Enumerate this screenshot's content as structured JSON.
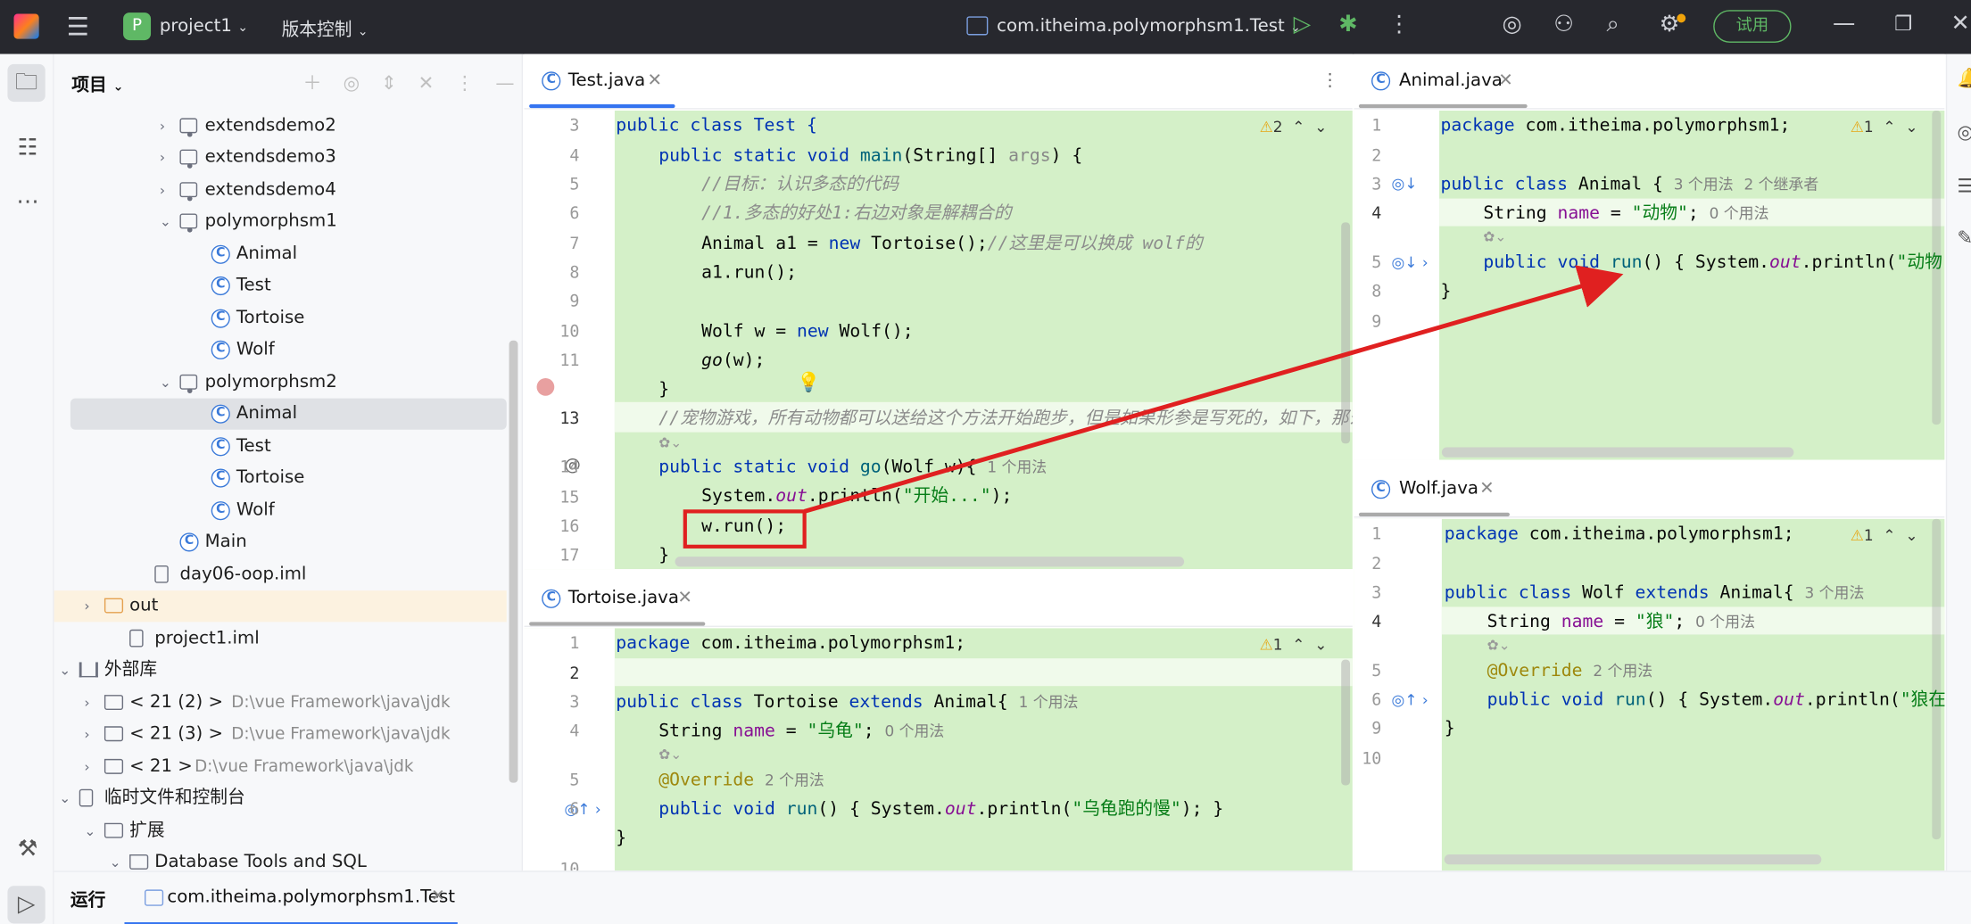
{
  "titlebar": {
    "project_letter": "P",
    "project": "project1",
    "vcs": "版本控制",
    "run_config": "com.itheima.polymorphsm1.Test",
    "trial": "试用"
  },
  "project_panel": {
    "title": "项目",
    "rows": [
      {
        "label": "extendsdemo2",
        "kind": "package",
        "chev": "›"
      },
      {
        "label": "extendsdemo3",
        "kind": "package",
        "chev": "›"
      },
      {
        "label": "extendsdemo4",
        "kind": "package",
        "chev": "›"
      },
      {
        "label": "polymorphsm1",
        "kind": "package",
        "chev": "⌄"
      },
      {
        "label": "Animal",
        "kind": "class"
      },
      {
        "label": "Test",
        "kind": "class-run"
      },
      {
        "label": "Tortoise",
        "kind": "class"
      },
      {
        "label": "Wolf",
        "kind": "class"
      },
      {
        "label": "polymorphsm2",
        "kind": "package",
        "chev": "⌄"
      },
      {
        "label": "Animal",
        "kind": "class"
      },
      {
        "label": "Test",
        "kind": "class-run"
      },
      {
        "label": "Tortoise",
        "kind": "class"
      },
      {
        "label": "Wolf",
        "kind": "class"
      },
      {
        "label": "Main",
        "kind": "class-run"
      },
      {
        "label": "day06-oop.iml",
        "kind": "file"
      },
      {
        "label": "out",
        "kind": "folder-orange",
        "chev": "›"
      },
      {
        "label": "project1.iml",
        "kind": "file"
      },
      {
        "label": "外部库",
        "kind": "lib",
        "chev": "⌄"
      },
      {
        "label": "< 21 (2) >",
        "path": "D:\\vue  Framework\\java\\jdk",
        "kind": "jdk",
        "chev": "›"
      },
      {
        "label": "< 21 (3) >",
        "path": "D:\\vue  Framework\\java\\jdk",
        "kind": "jdk",
        "chev": "›"
      },
      {
        "label": "< 21 >",
        "path": "D:\\vue  Framework\\java\\jdk",
        "kind": "jdk",
        "chev": "›"
      },
      {
        "label": "临时文件和控制台",
        "kind": "scratch",
        "chev": "⌄"
      },
      {
        "label": "扩展",
        "kind": "folder",
        "chev": "⌄"
      },
      {
        "label": "Database Tools and SQL",
        "kind": "folder",
        "chev": "⌄"
      }
    ]
  },
  "editors": {
    "test": {
      "tab": "Test.java",
      "warn": "2"
    },
    "animal": {
      "tab": "Animal.java",
      "warn": "1"
    },
    "tortoise": {
      "tab": "Tortoise.java",
      "warn": "1"
    },
    "wolf": {
      "tab": "Wolf.java",
      "warn": "1"
    }
  },
  "code": {
    "test": {
      "l3": "public class Test {",
      "l4a": "public static void ",
      "l4b": "main",
      "l4c": "(String[] ",
      "l4d": "args",
      ") {": ") {",
      "l5": "//目标：认识多态的代码",
      "l6": "//1.多态的好处1:右边对象是解耦合的",
      "l7a": "Animal a1 = ",
      "l7b": "new ",
      "l7c": "Tortoise();",
      "l7d": "//这里是可以换成 wolf的",
      "l8": "a1.run();",
      "l10a": "Wolf w = ",
      "l10b": "new ",
      "l10c": "Wolf();",
      "l11a": "go",
      "l11b": "(w);",
      "l12": "}",
      "l13": "//宠物游戏，所有动物都可以送给这个方法开始跑步，但是如果形参是写死的，如下，那么就",
      "l14a": "public static void ",
      "l14b": "go",
      "l14c": "(Wolf w){",
      "l14h": "1 个用法",
      "l15a": "System.",
      "l15b": "out",
      "l15c": ".println(",
      "l15d": "\"开始...\"",
      "l15e": ");",
      "l16": "w.run();",
      "l17": "}"
    },
    "animal": {
      "l1a": "package ",
      "l1b": "com.itheima.polymorphsm1;",
      "l3a": "public class ",
      "l3b": "Animal {",
      "l3h1": "3 个用法",
      "l3h2": "2 个继承者",
      "l4a": "String ",
      "l4b": "name",
      " = ": " = ",
      "l4c": "\"动物\"",
      "l4d": ";",
      "l4h": "0 个用法",
      "l5a": "public void ",
      "l5b": "run",
      "l5c": "() { System.",
      "l5d": "out",
      "l5e": ".println(",
      "l5f": "\"动物",
      "l8": "}"
    },
    "tortoise": {
      "l1a": "package ",
      "l1b": "com.itheima.polymorphsm1;",
      "l3a": "public class ",
      "l3b": "Tortoise ",
      "l3c": "extends ",
      "l3d": "Animal{",
      "l3h": "1 个用法",
      "l4a": "String ",
      "l4b": "name",
      " = ": " = ",
      "l4c": "\"乌龟\"",
      "l4d": ";",
      "l4h": "0 个用法",
      "l5a": "@Override",
      "l5h": "2 个用法",
      "l6a": "public void ",
      "l6b": "run",
      "l6c": "() { System.",
      "l6d": "out",
      "l6e": ".println(",
      "l6f": "\"乌龟跑的慢\"",
      "l6g": "); }",
      "l7": "}"
    },
    "wolf": {
      "l1a": "package ",
      "l1b": "com.itheima.polymorphsm1;",
      "l3a": "public class ",
      "l3b": "Wolf ",
      "l3c": "extends ",
      "l3d": "Animal{",
      "l3h": "3 个用法",
      "l4a": "String ",
      "l4b": "name",
      " = ": " = ",
      "l4c": "\"狼\"",
      "l4d": ";",
      "l4h": "0 个用法",
      "l5a": "@Override",
      "l5h": "2 个用法",
      "l6a": "public void ",
      "l6b": "run",
      "l6c": "() { System.",
      "l6d": "out",
      "l6e": ".println(",
      "l6f": "\"狼在",
      "l9": "}"
    }
  },
  "bottom": {
    "run": "运行",
    "config": "com.itheima.polymorphsm1.Test"
  },
  "colors": {
    "annotation_red": "#e02020",
    "code_bg": "#d4f0c8",
    "accent": "#3574f0"
  }
}
